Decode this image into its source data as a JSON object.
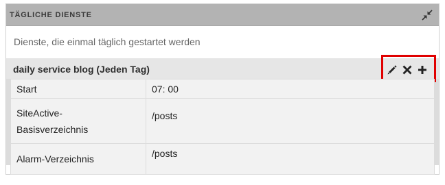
{
  "panel": {
    "title": "TÄGLICHE DIENSTE",
    "collapse_icon": "collapse-arrows-icon",
    "description": "Dienste, die einmal täglich gestartet werden"
  },
  "service": {
    "title": "daily service blog (Jeden Tag)",
    "actions": {
      "edit_icon": "pencil-icon",
      "delete_icon": "close-icon",
      "add_icon": "plus-icon",
      "highlight_color": "#e00000"
    },
    "properties": [
      {
        "key": "Start",
        "value": "07: 00"
      },
      {
        "key_line1": "SiteActive-",
        "key_line2": "Basisverzeichnis",
        "value": "/posts"
      },
      {
        "key": "Alarm-Verzeichnis",
        "value": "/posts"
      }
    ]
  },
  "colors": {
    "header_bg": "#b3b3b3",
    "service_bg": "#dcdcdc",
    "row_bg": "#f2f2f2"
  }
}
